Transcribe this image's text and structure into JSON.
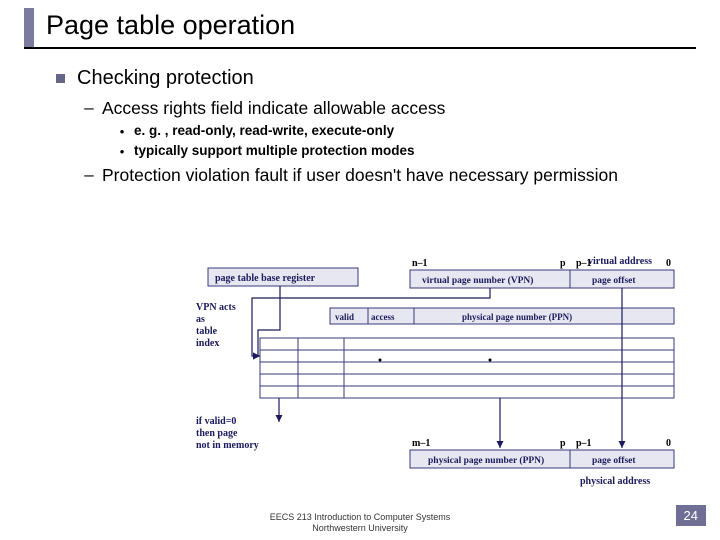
{
  "title": "Page table operation",
  "bullets": {
    "l1": "Checking protection",
    "l2a": "Access rights field indicate allowable access",
    "l3a": "e. g. , read-only, read-write, execute-only",
    "l3b": "typically support multiple protection modes",
    "l2b": "Protection violation fault if user doesn't have necessary permission"
  },
  "diagram": {
    "ptbr": "page table base register",
    "vpn_acts": "VPN acts as table index",
    "va": "virtual address",
    "vpn": "virtual page number (VPN)",
    "po": "page offset",
    "valid": "valid",
    "access": "access",
    "ppn": "physical page number (PPN)",
    "ifvalid": "if valid=0 then page not in memory",
    "pa": "physical address",
    "n1": "n–1",
    "p": "p",
    "p1": "p–1",
    "zero": "0",
    "m1": "m–1"
  },
  "footer": {
    "line1": "EECS 213 Introduction to Computer Systems",
    "line2": "Northwestern University"
  },
  "pagenum": "24"
}
